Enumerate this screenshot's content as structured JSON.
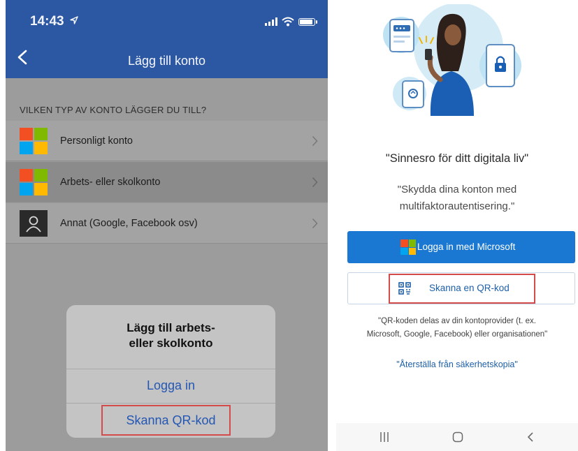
{
  "left": {
    "status_time": "14:43",
    "nav_title": "Lägg till konto",
    "section_label": "VILKEN TYP AV KONTO LÄGGER DU TILL?",
    "accounts": [
      {
        "label": "Personligt konto",
        "icon": "microsoft-logo-icon"
      },
      {
        "label": "Arbets- eller skolkonto",
        "icon": "microsoft-logo-icon"
      },
      {
        "label": "Annat (Google, Facebook osv)",
        "icon": "person-icon"
      }
    ],
    "sheet": {
      "title_line1": "Lägg till arbets-",
      "title_line2": "eller skolkonto",
      "login": "Logga in",
      "scan": "Skanna QR-kod"
    }
  },
  "right": {
    "tagline": "\"Sinnesro för ditt digitala liv\"",
    "subtag_line1": "\"Skydda dina konton med",
    "subtag_line2": "multifaktorautentisering.\"",
    "ms_button": "Logga in med Microsoft",
    "qr_button": "Skanna en QR-kod",
    "qr_note_line1": "\"QR-koden delas av din kontoprovider (t. ex.",
    "qr_note_line2": "Microsoft, Google, Facebook) eller organisationen\"",
    "restore": "\"Återställa från säkerhetskopia\""
  },
  "colors": {
    "ios_header": "#2c57a2",
    "ios_link": "#2457b3",
    "ms_button": "#1b78d2",
    "highlight": "#d44b4b",
    "ms_red": "#f25022",
    "ms_green": "#7fba00",
    "ms_blue": "#00a4ef",
    "ms_yellow": "#ffb900"
  }
}
